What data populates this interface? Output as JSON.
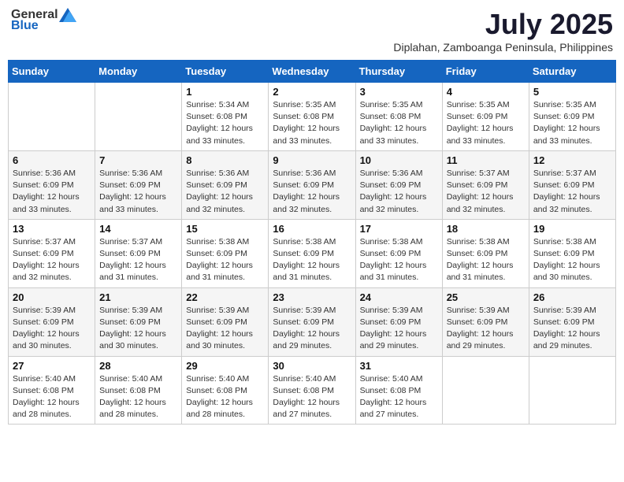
{
  "header": {
    "logo_general": "General",
    "logo_blue": "Blue",
    "month_year": "July 2025",
    "location": "Diplahan, Zamboanga Peninsula, Philippines"
  },
  "weekdays": [
    "Sunday",
    "Monday",
    "Tuesday",
    "Wednesday",
    "Thursday",
    "Friday",
    "Saturday"
  ],
  "weeks": [
    [
      {
        "day": "",
        "info": ""
      },
      {
        "day": "",
        "info": ""
      },
      {
        "day": "1",
        "info": "Sunrise: 5:34 AM\nSunset: 6:08 PM\nDaylight: 12 hours\nand 33 minutes."
      },
      {
        "day": "2",
        "info": "Sunrise: 5:35 AM\nSunset: 6:08 PM\nDaylight: 12 hours\nand 33 minutes."
      },
      {
        "day": "3",
        "info": "Sunrise: 5:35 AM\nSunset: 6:08 PM\nDaylight: 12 hours\nand 33 minutes."
      },
      {
        "day": "4",
        "info": "Sunrise: 5:35 AM\nSunset: 6:09 PM\nDaylight: 12 hours\nand 33 minutes."
      },
      {
        "day": "5",
        "info": "Sunrise: 5:35 AM\nSunset: 6:09 PM\nDaylight: 12 hours\nand 33 minutes."
      }
    ],
    [
      {
        "day": "6",
        "info": "Sunrise: 5:36 AM\nSunset: 6:09 PM\nDaylight: 12 hours\nand 33 minutes."
      },
      {
        "day": "7",
        "info": "Sunrise: 5:36 AM\nSunset: 6:09 PM\nDaylight: 12 hours\nand 33 minutes."
      },
      {
        "day": "8",
        "info": "Sunrise: 5:36 AM\nSunset: 6:09 PM\nDaylight: 12 hours\nand 32 minutes."
      },
      {
        "day": "9",
        "info": "Sunrise: 5:36 AM\nSunset: 6:09 PM\nDaylight: 12 hours\nand 32 minutes."
      },
      {
        "day": "10",
        "info": "Sunrise: 5:36 AM\nSunset: 6:09 PM\nDaylight: 12 hours\nand 32 minutes."
      },
      {
        "day": "11",
        "info": "Sunrise: 5:37 AM\nSunset: 6:09 PM\nDaylight: 12 hours\nand 32 minutes."
      },
      {
        "day": "12",
        "info": "Sunrise: 5:37 AM\nSunset: 6:09 PM\nDaylight: 12 hours\nand 32 minutes."
      }
    ],
    [
      {
        "day": "13",
        "info": "Sunrise: 5:37 AM\nSunset: 6:09 PM\nDaylight: 12 hours\nand 32 minutes."
      },
      {
        "day": "14",
        "info": "Sunrise: 5:37 AM\nSunset: 6:09 PM\nDaylight: 12 hours\nand 31 minutes."
      },
      {
        "day": "15",
        "info": "Sunrise: 5:38 AM\nSunset: 6:09 PM\nDaylight: 12 hours\nand 31 minutes."
      },
      {
        "day": "16",
        "info": "Sunrise: 5:38 AM\nSunset: 6:09 PM\nDaylight: 12 hours\nand 31 minutes."
      },
      {
        "day": "17",
        "info": "Sunrise: 5:38 AM\nSunset: 6:09 PM\nDaylight: 12 hours\nand 31 minutes."
      },
      {
        "day": "18",
        "info": "Sunrise: 5:38 AM\nSunset: 6:09 PM\nDaylight: 12 hours\nand 31 minutes."
      },
      {
        "day": "19",
        "info": "Sunrise: 5:38 AM\nSunset: 6:09 PM\nDaylight: 12 hours\nand 30 minutes."
      }
    ],
    [
      {
        "day": "20",
        "info": "Sunrise: 5:39 AM\nSunset: 6:09 PM\nDaylight: 12 hours\nand 30 minutes."
      },
      {
        "day": "21",
        "info": "Sunrise: 5:39 AM\nSunset: 6:09 PM\nDaylight: 12 hours\nand 30 minutes."
      },
      {
        "day": "22",
        "info": "Sunrise: 5:39 AM\nSunset: 6:09 PM\nDaylight: 12 hours\nand 30 minutes."
      },
      {
        "day": "23",
        "info": "Sunrise: 5:39 AM\nSunset: 6:09 PM\nDaylight: 12 hours\nand 29 minutes."
      },
      {
        "day": "24",
        "info": "Sunrise: 5:39 AM\nSunset: 6:09 PM\nDaylight: 12 hours\nand 29 minutes."
      },
      {
        "day": "25",
        "info": "Sunrise: 5:39 AM\nSunset: 6:09 PM\nDaylight: 12 hours\nand 29 minutes."
      },
      {
        "day": "26",
        "info": "Sunrise: 5:39 AM\nSunset: 6:09 PM\nDaylight: 12 hours\nand 29 minutes."
      }
    ],
    [
      {
        "day": "27",
        "info": "Sunrise: 5:40 AM\nSunset: 6:08 PM\nDaylight: 12 hours\nand 28 minutes."
      },
      {
        "day": "28",
        "info": "Sunrise: 5:40 AM\nSunset: 6:08 PM\nDaylight: 12 hours\nand 28 minutes."
      },
      {
        "day": "29",
        "info": "Sunrise: 5:40 AM\nSunset: 6:08 PM\nDaylight: 12 hours\nand 28 minutes."
      },
      {
        "day": "30",
        "info": "Sunrise: 5:40 AM\nSunset: 6:08 PM\nDaylight: 12 hours\nand 27 minutes."
      },
      {
        "day": "31",
        "info": "Sunrise: 5:40 AM\nSunset: 6:08 PM\nDaylight: 12 hours\nand 27 minutes."
      },
      {
        "day": "",
        "info": ""
      },
      {
        "day": "",
        "info": ""
      }
    ]
  ]
}
